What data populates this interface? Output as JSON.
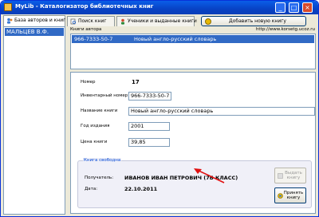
{
  "window": {
    "title": "MyLib - Каталогизатор библиотечных книг"
  },
  "tabs": [
    {
      "label": "База авторов и книг"
    },
    {
      "label": "Поиск книг"
    },
    {
      "label": "Ученики и выданные книги"
    }
  ],
  "toolbar": {
    "add_book_label": "Добавить новую книгу"
  },
  "authors": {
    "selected": "МАЛЬЦЕВ В.Ф."
  },
  "books": {
    "header": "Книги автора",
    "site": "http://www.korsetg.ucoz.ru",
    "rows": [
      {
        "id": "966-7333-50-7",
        "title": "Новый англо-русский словарь"
      }
    ]
  },
  "detail": {
    "number_label": "Номер",
    "number_value": "17",
    "inventory_label": "Инвентарный номер",
    "inventory_value": "966-7333-50-7",
    "name_label": "Название книги",
    "name_value": "Новый англо-русский словарь",
    "year_label": "Год издания",
    "year_value": "2001",
    "price_label": "Цена книги",
    "price_value": "39,85"
  },
  "availability": {
    "group_title": "Книга свободна",
    "holder_label": "Получатель:",
    "holder_value": "ИВАНОВ ИВАН ПЕТРОВИЧ (7Б КЛАСС)",
    "date_label": "Дата:",
    "date_value": "22.10.2011",
    "issue_button": "Выдать книгу",
    "accept_button": "Принять книгу"
  },
  "colors": {
    "titlebar": "#0a5ee8",
    "selection": "#316ac5",
    "arrow": "#e01010"
  }
}
